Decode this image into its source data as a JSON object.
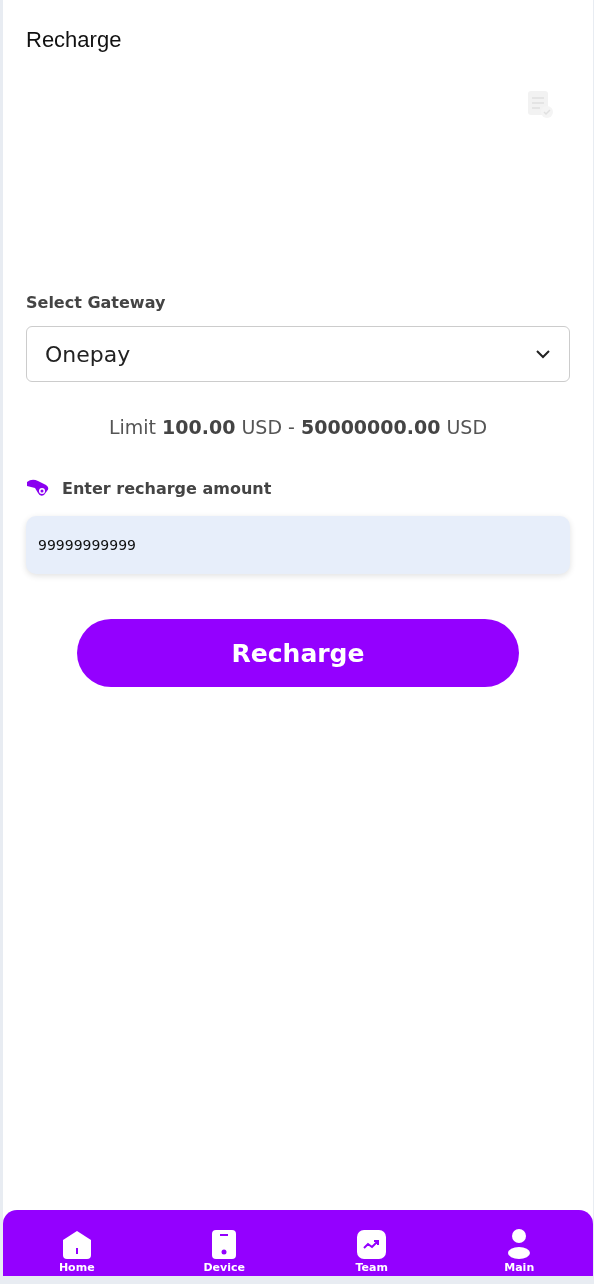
{
  "header": {
    "title": "Recharge"
  },
  "gateway": {
    "label": "Select Gateway",
    "value": "Onepay"
  },
  "limit": "Limit **100.00** USD - **50000000.00** USD",
  "amount": {
    "label": "Enter recharge amount",
    "value": "99999999999"
  },
  "submit": "Recharge",
  "nav": [
    {
      "label": "Home",
      "kind": "home"
    },
    {
      "label": "Device",
      "kind": "device"
    },
    {
      "label": "Team",
      "kind": "team"
    },
    {
      "label": "Main",
      "kind": "main"
    }
  ]
}
